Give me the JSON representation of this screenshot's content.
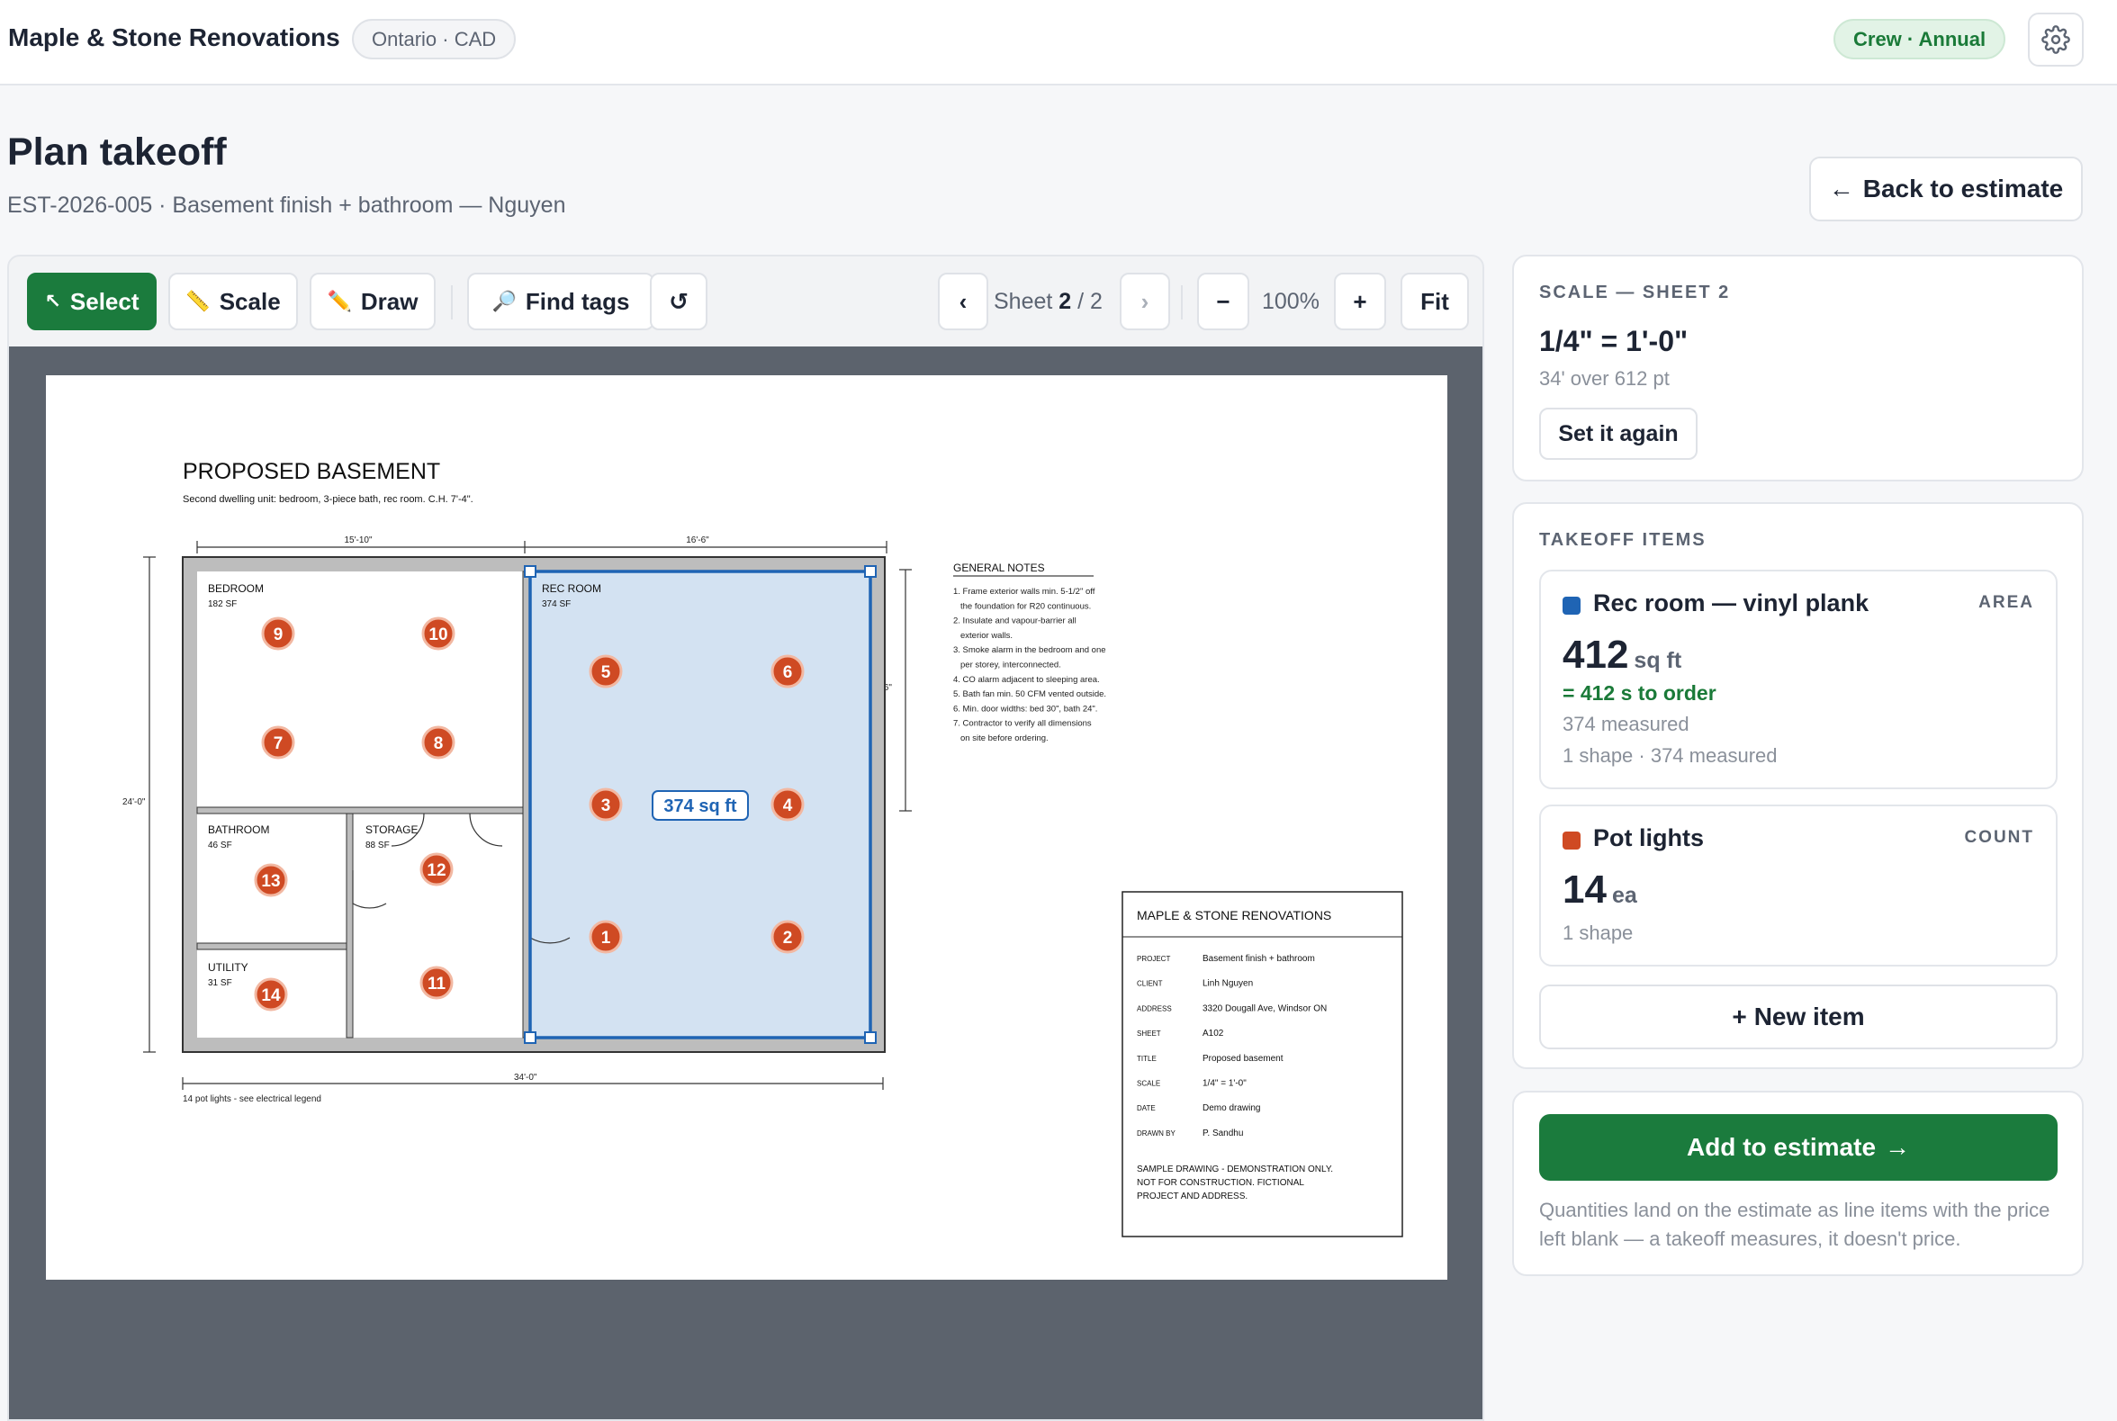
{
  "header": {
    "brand": "Maple & Stone Renovations",
    "region": "Ontario · CAD",
    "plan_badge": "Crew · Annual",
    "settings_icon": "gear-icon"
  },
  "page": {
    "title": "Plan takeoff",
    "subtitle": "EST-2026-005 · Basement finish + bathroom — Nguyen",
    "back_label": "Back to estimate",
    "back_icon": "←"
  },
  "toolbar": {
    "select_label": "Select",
    "select_icon": "↖",
    "scale_label": "Scale",
    "scale_icon": "📏",
    "draw_label": "Draw",
    "draw_icon": "✏️",
    "find_label": "Find tags",
    "find_icon": "🔎",
    "undo_icon": "↺",
    "prev_icon": "‹",
    "next_icon": "›",
    "sheet_word": "Sheet",
    "sheet_current": "2",
    "sheet_sep": " / 2",
    "zoom_out_icon": "−",
    "zoom_value": "100%",
    "zoom_in_icon": "+",
    "fit_label": "Fit"
  },
  "drawing": {
    "title": "PROPOSED BASEMENT",
    "subtitle": "Second dwelling unit: bedroom, 3-piece bath, rec room. C.H. 7'-4\".",
    "dim_top_left": "15'-10\"",
    "dim_top_right": "16'-6\"",
    "dim_left": "24'-0\"",
    "dim_right": "1'-6\"",
    "dim_bottom": "34'-0\"",
    "legend_note": "14 pot lights - see electrical legend",
    "rooms": [
      {
        "name": "BEDROOM",
        "area": "182 SF"
      },
      {
        "name": "REC ROOM",
        "area": "374 SF"
      },
      {
        "name": "BATHROOM",
        "area": "46 SF"
      },
      {
        "name": "STORAGE",
        "area": "88 SF"
      },
      {
        "name": "UTILITY",
        "area": "31 SF"
      }
    ],
    "measure_label": "374 sq ft",
    "pins": [
      "1",
      "2",
      "3",
      "4",
      "5",
      "6",
      "7",
      "8",
      "9",
      "10",
      "11",
      "12",
      "13",
      "14"
    ],
    "notes_title": "GENERAL NOTES",
    "notes": [
      "1. Frame exterior walls min. 5-1/2\" off",
      "the foundation for R20 continuous.",
      "2. Insulate and vapour-barrier all",
      "exterior walls.",
      "3. Smoke alarm in the bedroom and one",
      "per storey, interconnected.",
      "4. CO alarm adjacent to sleeping area.",
      "5. Bath fan min. 50 CFM vented outside.",
      "6. Min. door widths: bed 30\", bath 24\".",
      "7. Contractor to verify all dimensions",
      "on site before ordering."
    ],
    "titleblock": {
      "company": "MAPLE & STONE RENOVATIONS",
      "rows": [
        {
          "k": "PROJECT",
          "v": "Basement finish + bathroom"
        },
        {
          "k": "CLIENT",
          "v": "Linh Nguyen"
        },
        {
          "k": "ADDRESS",
          "v": "3320 Dougall Ave, Windsor ON"
        },
        {
          "k": "SHEET",
          "v": "A102"
        },
        {
          "k": "TITLE",
          "v": "Proposed basement"
        },
        {
          "k": "SCALE",
          "v": "1/4\" = 1'-0\""
        },
        {
          "k": "DATE",
          "v": "Demo drawing"
        },
        {
          "k": "DRAWN BY",
          "v": "P. Sandhu"
        }
      ],
      "disclaimer": [
        "SAMPLE DRAWING - DEMONSTRATION ONLY.",
        "NOT FOR CONSTRUCTION. FICTIONAL",
        "PROJECT AND ADDRESS."
      ]
    }
  },
  "scale_panel": {
    "caption": "SCALE — SHEET 2",
    "value": "1/4\" = 1'-0\"",
    "detail": "34' over 612 pt",
    "reset_label": "Set it again"
  },
  "takeoff": {
    "caption": "TAKEOFF ITEMS",
    "items": [
      {
        "name": "Rec room — vinyl plank",
        "type": "AREA",
        "color": "#1f64b4",
        "qty": "412",
        "unit": "sq ft",
        "order": "= 412 s to order",
        "measured": "374 measured",
        "meta": "1 shape · 374 measured"
      },
      {
        "name": "Pot lights",
        "type": "COUNT",
        "color": "#cf4a23",
        "qty": "14",
        "unit": "ea",
        "meta": "1 shape"
      }
    ],
    "new_item_label": "New item",
    "new_item_icon": "+"
  },
  "estimate": {
    "add_label": "Add to estimate",
    "add_icon": "→",
    "note": "Quantities land on the estimate as line items with the price left blank — a takeoff measures, it doesn't price."
  },
  "colors": {
    "accent": "#1b7b3d",
    "selection": "#1f64b4",
    "pin": "#cf4a23",
    "canvas": "#5c636d"
  }
}
